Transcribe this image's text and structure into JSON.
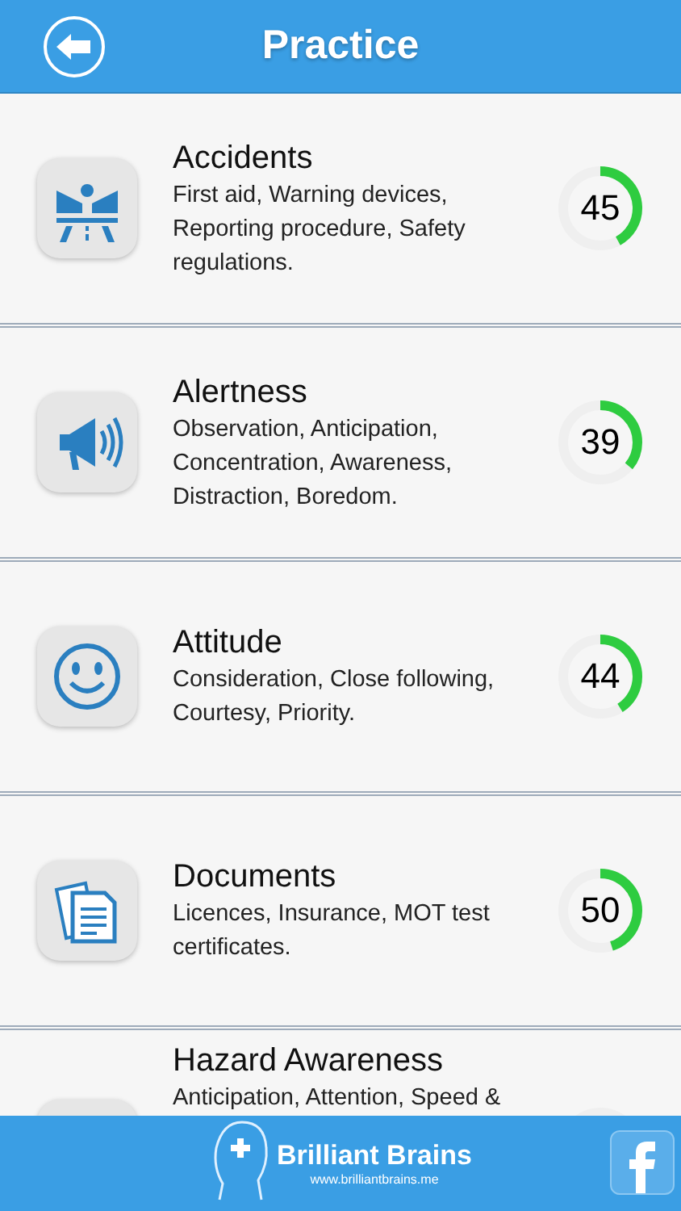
{
  "header": {
    "title": "Practice"
  },
  "topics": [
    {
      "kind": "accidents",
      "title": "Accidents",
      "description": "First aid, Warning devices, Reporting procedure, Safety regulations.",
      "score": "45",
      "level": 0.42
    },
    {
      "kind": "alertness",
      "title": "Alertness",
      "description": "Observation, Anticipation, Concentration, Awareness, Distraction, Boredom.",
      "score": "39",
      "level": 0.36
    },
    {
      "kind": "attitude",
      "title": "Attitude",
      "description": "Consideration, Close following, Courtesy, Priority.",
      "score": "44",
      "level": 0.41
    },
    {
      "kind": "documents",
      "title": "Documents",
      "description": "Licences, Insurance, MOT test certificates.",
      "score": "50",
      "level": 0.45
    },
    {
      "kind": "hazard",
      "title": "Hazard Awareness",
      "description": "Anticipation, Attention, Speed &"
    }
  ],
  "footer": {
    "brand": "Brilliant Brains",
    "url": "www.brilliantbrains.me"
  }
}
